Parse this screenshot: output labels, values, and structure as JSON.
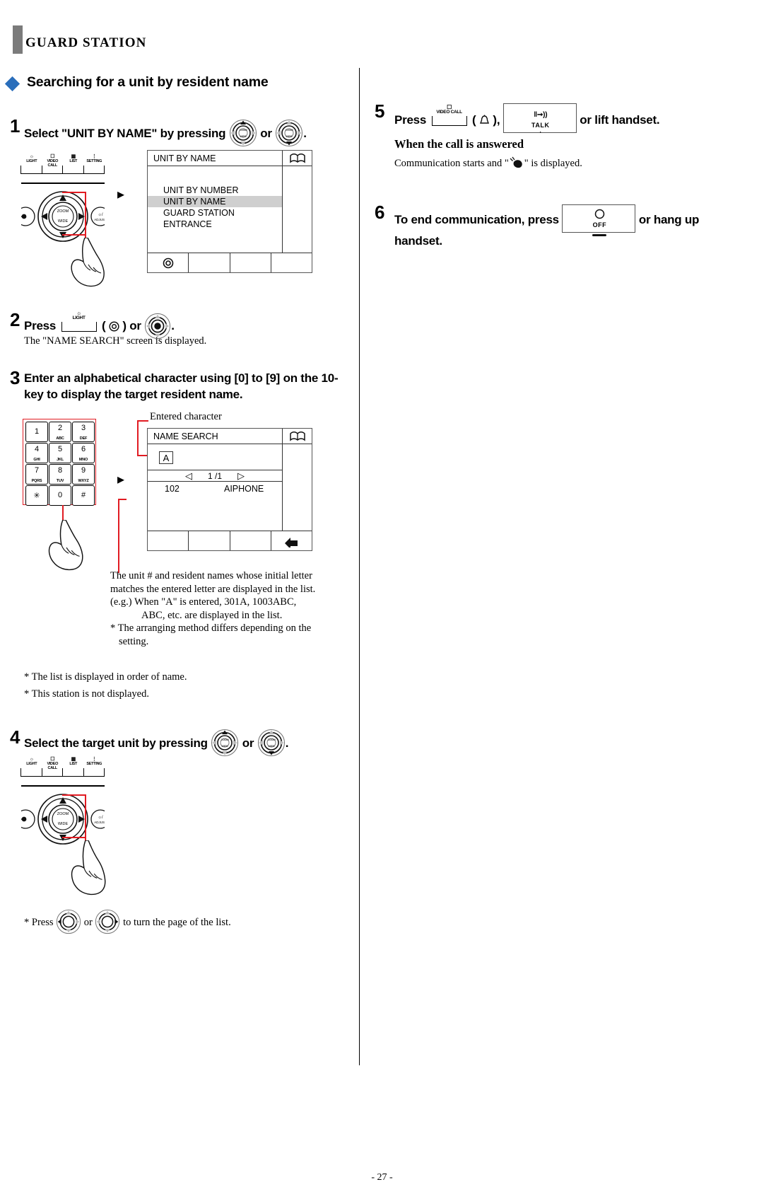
{
  "header": {
    "title": "GUARD STATION"
  },
  "section": {
    "heading": "Searching for a unit by resident name",
    "bullet_color": "#2a6ebb"
  },
  "page": {
    "number": "- 27 -"
  },
  "steps": {
    "s1": {
      "num": "1",
      "text_a": "Select \"UNIT BY NAME\" by pressing",
      "text_or": "or",
      "text_end": "."
    },
    "s2": {
      "num": "2",
      "text_a": "Press",
      "text_mid": "(       ) or",
      "text_end": ".",
      "note": "The \"NAME SEARCH\" screen is displayed."
    },
    "s3": {
      "num": "3",
      "text": "Enter an alphabetical character using [0] to [9] on the 10-key to display the target resident name."
    },
    "s4": {
      "num": "4",
      "text_a": "Select the target unit by pressing",
      "text_or": "or",
      "text_end": "."
    },
    "s5": {
      "num": "5",
      "text_a": "Press",
      "text_mid": "(      ),",
      "text_end": "or lift handset.",
      "answered_heading": "When the call is answered",
      "answered_body_a": "Communication starts and \"",
      "answered_body_b": "\" is displayed."
    },
    "s6": {
      "num": "6",
      "text_a": "To end communication, press",
      "text_end": "or hang up handset."
    }
  },
  "callouts": {
    "entered_character": "Entered character",
    "list_explanation_line1": "The unit # and resident names whose initial letter",
    "list_explanation_line2": "matches the entered letter are displayed in the list.",
    "list_explanation_line3": "(e.g.) When \"A\" is entered, 301A, 1003ABC,",
    "list_explanation_line4": "ABC, etc. are displayed in the list.",
    "list_explanation_line5": "* The arranging method differs depending on the",
    "list_explanation_line6": "setting."
  },
  "notes": {
    "n1": "*   The list is displayed in order of name.",
    "n2": "*   This station is not displayed.",
    "page_turn_a": "*   Press",
    "page_turn_or": "or",
    "page_turn_b": "to turn the page of the list."
  },
  "lcd_unit_by_name": {
    "title": "UNIT BY NAME",
    "book_icon": "book-icon",
    "items": [
      {
        "label": "UNIT BY NUMBER",
        "selected": false
      },
      {
        "label": "UNIT BY NAME",
        "selected": true
      },
      {
        "label": "GUARD STATION",
        "selected": false
      },
      {
        "label": "ENTRANCE",
        "selected": false
      }
    ]
  },
  "lcd_name_search": {
    "title": "NAME SEARCH",
    "book_icon": "book-icon",
    "entered_char": "A",
    "page_indicator": "1 /1",
    "prev_icon": "triangle-left-icon",
    "next_icon": "triangle-right-icon",
    "results": [
      {
        "unit": "102",
        "name": "AIPHONE"
      }
    ],
    "enter_icon": "enter-return-icon"
  },
  "panel_buttons": {
    "items": [
      {
        "label": "LIGHT",
        "icon": "light-bulb-icon"
      },
      {
        "label": "VIDEO CALL",
        "icon": "video-call-icon"
      },
      {
        "label": "LIST",
        "icon": "list-icon"
      },
      {
        "label": "SETTING",
        "icon": "setting-icon"
      }
    ],
    "left_knob": "door-release-icon",
    "right_knob": "brightness-volume-adjust-icon",
    "center_jog": {
      "line1": "ZOOM",
      "line2": "WIDE",
      "icon": "magnifier-icon"
    }
  },
  "keypad": {
    "keys": [
      {
        "digit": "1",
        "sub": ""
      },
      {
        "digit": "2",
        "sub": "ABC"
      },
      {
        "digit": "3",
        "sub": "DEF"
      },
      {
        "digit": "4",
        "sub": "GHI"
      },
      {
        "digit": "5",
        "sub": "JKL"
      },
      {
        "digit": "6",
        "sub": "MNO"
      },
      {
        "digit": "7",
        "sub": "PQRS"
      },
      {
        "digit": "8",
        "sub": "TUV"
      },
      {
        "digit": "9",
        "sub": "WXYZ"
      },
      {
        "digit": "✳",
        "sub": ""
      },
      {
        "digit": "0",
        "sub": ""
      },
      {
        "digit": "#",
        "sub": ""
      }
    ]
  },
  "hard_keys": {
    "light": {
      "label": "LIGHT",
      "icon": "light-bulb-icon"
    },
    "video_call": {
      "label": "VIDEO CALL",
      "icon": "video-call-icon"
    },
    "talk": {
      "label": "TALK",
      "icon": "talk-speaker-icon"
    },
    "off": {
      "label": "OFF",
      "icon": "off-circle-icon"
    }
  }
}
